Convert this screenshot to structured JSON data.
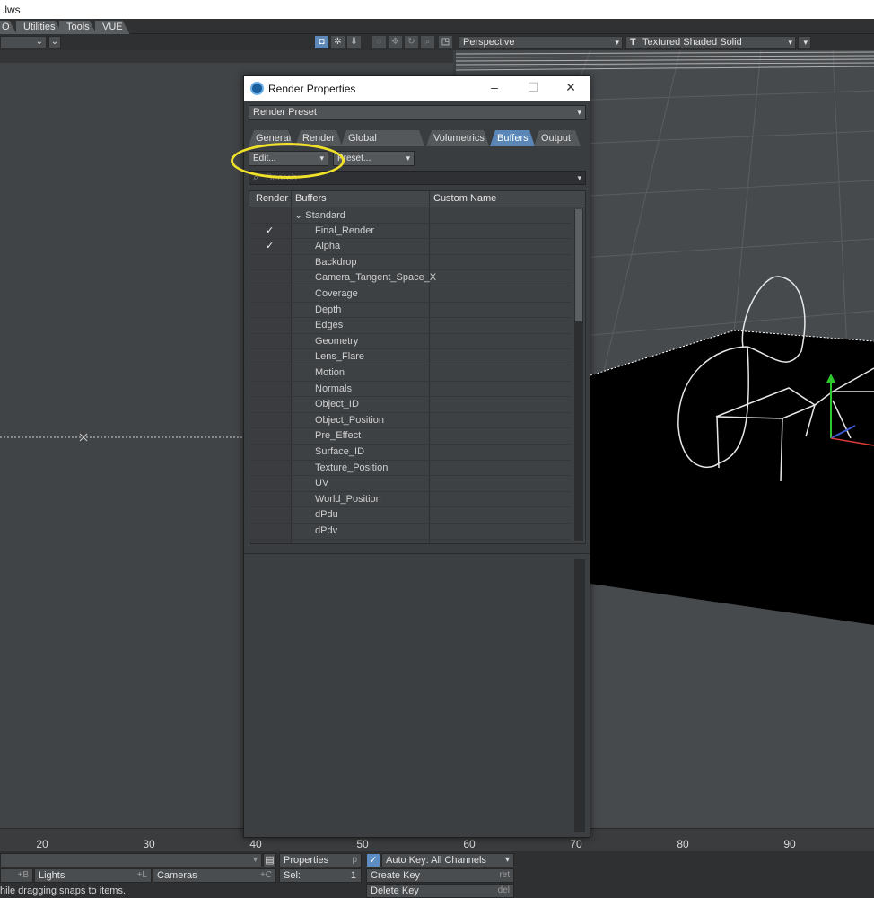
{
  "window": {
    "title_fragment": ".lws"
  },
  "menu_tabs": [
    "O",
    "Utilities",
    "Tools",
    "VUE"
  ],
  "viewport": {
    "projection": "Perspective",
    "shading": "Textured Shaded Solid"
  },
  "toolbar_icons": [
    "camera-icon",
    "gear-icon",
    "export-icon",
    "circle-icon",
    "move-icon",
    "rotate-icon",
    "zoom-icon",
    "maximize-icon"
  ],
  "dialog": {
    "title": "Render Properties",
    "preset": "Render Preset",
    "tabs": [
      "General",
      "Render",
      "Global Illumination",
      "Volumetrics",
      "Buffers",
      "Output"
    ],
    "active_tab": "Buffers",
    "edit_dropdown": "Edit...",
    "preset_dropdown": "Preset...",
    "search_placeholder": "Search",
    "columns": [
      "Render",
      "Buffers",
      "Custom Name"
    ],
    "group": "Standard",
    "buffers": [
      {
        "name": "Final_Render",
        "checked": true
      },
      {
        "name": "Alpha",
        "checked": true
      },
      {
        "name": "Backdrop",
        "checked": false
      },
      {
        "name": "Camera_Tangent_Space_X",
        "checked": false
      },
      {
        "name": "Coverage",
        "checked": false
      },
      {
        "name": "Depth",
        "checked": false
      },
      {
        "name": "Edges",
        "checked": false
      },
      {
        "name": "Geometry",
        "checked": false
      },
      {
        "name": "Lens_Flare",
        "checked": false
      },
      {
        "name": "Motion",
        "checked": false
      },
      {
        "name": "Normals",
        "checked": false
      },
      {
        "name": "Object_ID",
        "checked": false
      },
      {
        "name": "Object_Position",
        "checked": false
      },
      {
        "name": "Pre_Effect",
        "checked": false
      },
      {
        "name": "Surface_ID",
        "checked": false
      },
      {
        "name": "Texture_Position",
        "checked": false
      },
      {
        "name": "UV",
        "checked": false
      },
      {
        "name": "World_Position",
        "checked": false
      },
      {
        "name": "dPdu",
        "checked": false
      },
      {
        "name": "dPdv",
        "checked": false
      }
    ],
    "check_glyph": "✓"
  },
  "timeline": {
    "ticks": [
      "20",
      "30",
      "40",
      "50",
      "60",
      "70",
      "80",
      "90"
    ]
  },
  "bottom": {
    "lights": "Lights",
    "lights_shortcut": "+L",
    "left_shortcut": "+B",
    "cameras": "Cameras",
    "cameras_shortcut": "+C",
    "properties": "Properties",
    "properties_shortcut": "p",
    "sel_label": "Sel:",
    "sel_value": "1",
    "auto_key": "Auto Key: All Channels",
    "create_key": "Create Key",
    "create_key_shortcut": "ret",
    "delete_key": "Delete Key",
    "delete_key_shortcut": "del",
    "status": "hile dragging snaps to items."
  },
  "colors": {
    "accent": "#5a87b8",
    "highlight": "#f0e12a"
  }
}
